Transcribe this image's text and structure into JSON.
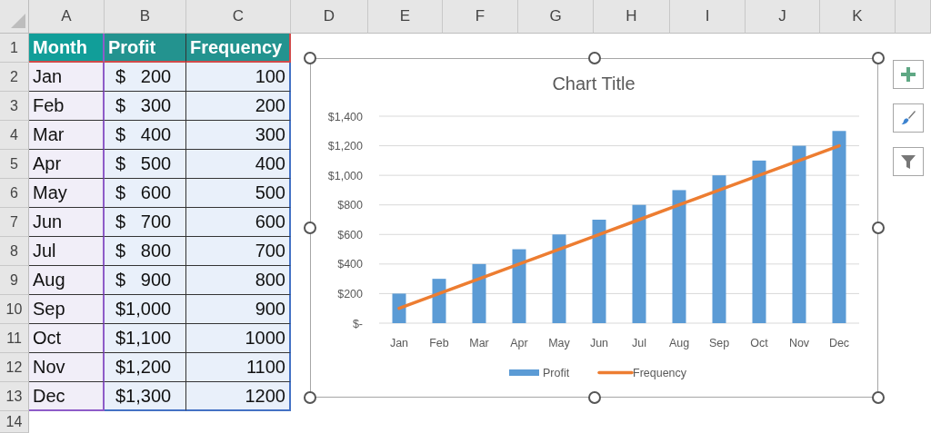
{
  "columns": [
    "A",
    "B",
    "C",
    "D",
    "E",
    "F",
    "G",
    "H",
    "I",
    "J",
    "K"
  ],
  "row_numbers": [
    "1",
    "2",
    "3",
    "4",
    "5",
    "6",
    "7",
    "8",
    "9",
    "10",
    "11",
    "12",
    "13",
    "14"
  ],
  "table": {
    "headers": [
      "Month",
      "Profit",
      "Frequency"
    ],
    "rows": [
      {
        "month": "Jan",
        "profit": "$   200",
        "frequency": "100"
      },
      {
        "month": "Feb",
        "profit": "$   300",
        "frequency": "200"
      },
      {
        "month": "Mar",
        "profit": "$   400",
        "frequency": "300"
      },
      {
        "month": "Apr",
        "profit": "$   500",
        "frequency": "400"
      },
      {
        "month": "May",
        "profit": "$   600",
        "frequency": "500"
      },
      {
        "month": "Jun",
        "profit": "$   700",
        "frequency": "600"
      },
      {
        "month": "Jul",
        "profit": "$   800",
        "frequency": "700"
      },
      {
        "month": "Aug",
        "profit": "$   900",
        "frequency": "800"
      },
      {
        "month": "Sep",
        "profit": "$1,000",
        "frequency": "900"
      },
      {
        "month": "Oct",
        "profit": "$1,100",
        "frequency": "1000"
      },
      {
        "month": "Nov",
        "profit": "$1,200",
        "frequency": "1100"
      },
      {
        "month": "Dec",
        "profit": "$1,300",
        "frequency": "1200"
      }
    ]
  },
  "chart": {
    "chart_data": {
      "type": "bar",
      "title": "Chart Title",
      "categories": [
        "Jan",
        "Feb",
        "Mar",
        "Apr",
        "May",
        "Jun",
        "Jul",
        "Aug",
        "Sep",
        "Oct",
        "Nov",
        "Dec"
      ],
      "series": [
        {
          "name": "Profit",
          "type": "bar",
          "color": "#5b9bd5",
          "values": [
            200,
            300,
            400,
            500,
            600,
            700,
            800,
            900,
            1000,
            1100,
            1200,
            1300
          ]
        },
        {
          "name": "Frequency",
          "type": "line",
          "color": "#ed7d31",
          "values": [
            100,
            200,
            300,
            400,
            500,
            600,
            700,
            800,
            900,
            1000,
            1100,
            1200
          ]
        }
      ],
      "grid": true,
      "legend": "bottom",
      "ylim": [
        0,
        1400
      ],
      "yticks": [
        {
          "value": 0,
          "label": "$-"
        },
        {
          "value": 200,
          "label": "$200"
        },
        {
          "value": 400,
          "label": "$400"
        },
        {
          "value": 600,
          "label": "$600"
        },
        {
          "value": 800,
          "label": "$800"
        },
        {
          "value": 1000,
          "label": "$1,000"
        },
        {
          "value": 1200,
          "label": "$1,200"
        },
        {
          "value": 1400,
          "label": "$1,400"
        }
      ]
    }
  },
  "chart_tools": [
    {
      "kind": "add"
    },
    {
      "kind": "style"
    },
    {
      "kind": "filter"
    }
  ]
}
